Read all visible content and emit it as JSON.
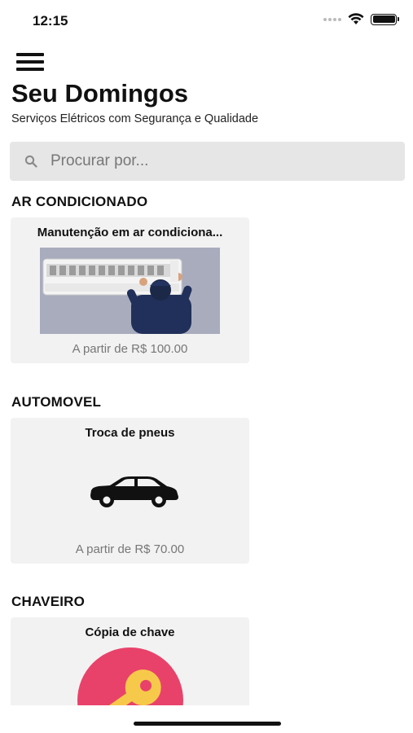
{
  "status_bar": {
    "time": "12:15"
  },
  "header": {
    "menu_icon": "hamburger-menu-icon",
    "title": "Seu Domingos",
    "subtitle": "Serviços Elétricos com Segurança e Qualidade"
  },
  "search": {
    "placeholder": "Procurar por...",
    "value": "",
    "icon": "search-icon"
  },
  "sections": [
    {
      "title": "AR CONDICIONADO",
      "cards": [
        {
          "title": "Manutenção em ar condiciona...",
          "price": "A partir de R$ 100.00",
          "image": "air-conditioner-technician-photo"
        }
      ]
    },
    {
      "title": "AUTOMOVEL",
      "cards": [
        {
          "title": "Troca de pneus",
          "price": "A partir de R$ 70.00",
          "image": "car-icon"
        }
      ]
    },
    {
      "title": "CHAVEIRO",
      "cards": [
        {
          "title": "Cópia de chave",
          "image": "key-icon"
        }
      ]
    }
  ],
  "colors": {
    "card_bg": "#f2f2f2",
    "search_bg": "#e6e6e6",
    "price_text": "#777777",
    "key_circle": "#e8426a",
    "key_yellow": "#f7c94a"
  }
}
